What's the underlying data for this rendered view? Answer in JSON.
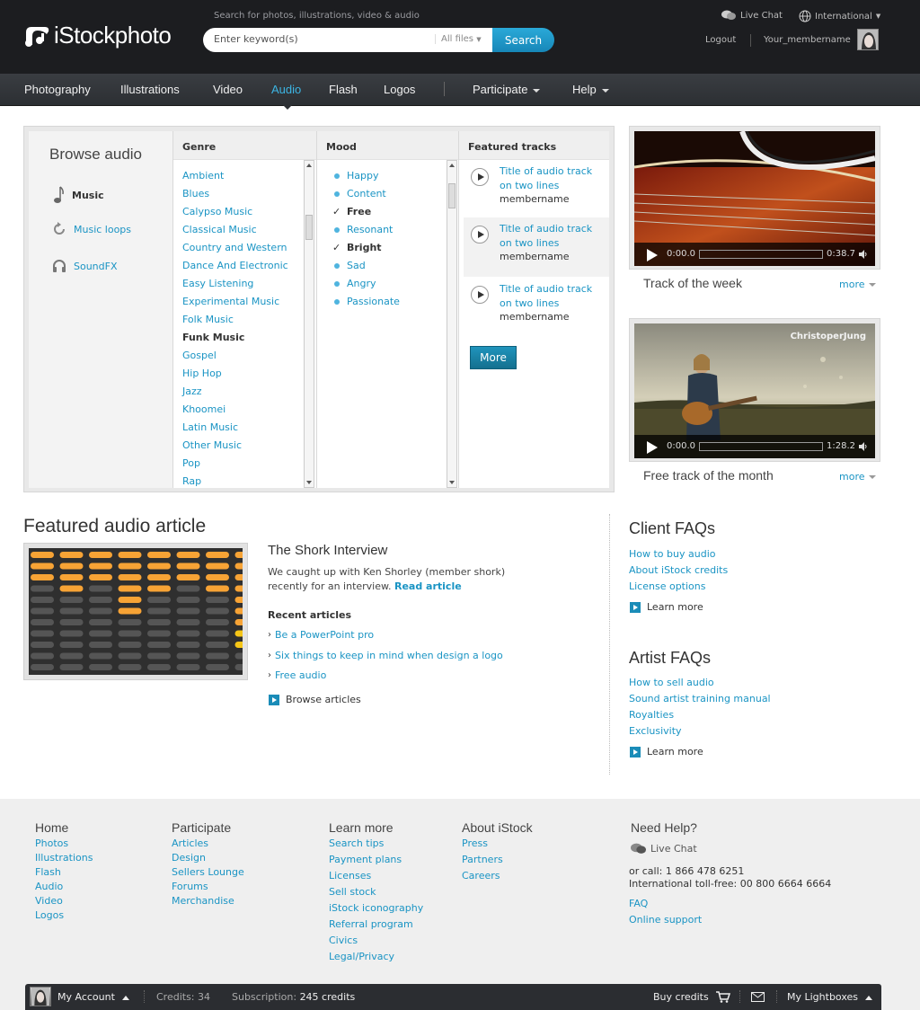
{
  "header": {
    "logo_text": "iStockphoto",
    "search_hint": "Search for photos, illustrations, video & audio",
    "search_placeholder": "Enter keyword(s)",
    "files_filter": "All files",
    "search_button": "Search",
    "live_chat": "Live Chat",
    "international": "International",
    "logout": "Logout",
    "member": "Your_membername"
  },
  "nav": {
    "items": [
      "Photography",
      "Illustrations",
      "Video",
      "Audio",
      "Flash",
      "Logos"
    ],
    "active": "Audio",
    "participate": "Participate",
    "help": "Help"
  },
  "browse": {
    "title": "Browse audio",
    "types": [
      "Music",
      "Music loops",
      "SoundFX"
    ],
    "active_type": "Music",
    "genre_header": "Genre",
    "mood_header": "Mood",
    "featured_header": "Featured tracks",
    "genres": [
      "Ambient",
      "Blues",
      "Calypso Music",
      "Classical Music",
      "Country and Western",
      "Dance And Electronic",
      "Easy Listening",
      "Experimental Music",
      "Folk Music",
      "Funk Music",
      "Gospel",
      "Hip Hop",
      "Jazz",
      "Khoomei",
      "Latin Music",
      "Other Music",
      "Pop",
      "Rap"
    ],
    "selected_genre": "Funk Music",
    "moods": [
      "Happy",
      "Content",
      "Free",
      "Resonant",
      "Bright",
      "Sad",
      "Angry",
      "Passionate"
    ],
    "checked_moods": [
      "Free",
      "Bright"
    ],
    "tracks": [
      {
        "title": "Title of audio track on two lines",
        "member": "membername"
      },
      {
        "title": "Title of audio track on two lines",
        "member": "membername"
      },
      {
        "title": "Title of audio track on two lines",
        "member": "membername"
      }
    ],
    "more_button": "More"
  },
  "videos": [
    {
      "current": "0:00.0",
      "duration": "0:38.7",
      "caption": "Track of the week",
      "more": "more"
    },
    {
      "current": "0:00.0",
      "duration": "1:28.2",
      "caption": "Free track of the month",
      "more": "more",
      "watermark": "ChristoperJung"
    }
  ],
  "article": {
    "section_title": "Featured audio article",
    "headline": "The Shork Interview",
    "desc": "We caught up with Ken Shorley (member shork) recently for an interview.",
    "read_link": "Read article",
    "recent_title": "Recent articles",
    "recent": [
      "Be a PowerPoint pro",
      "Six things to keep in mind when design a logo",
      "Free audio"
    ],
    "browse_link": "Browse articles"
  },
  "faqs": {
    "client_title": "Client FAQs",
    "client_links": [
      "How to buy audio",
      "About iStock credits",
      "License options"
    ],
    "artist_title": "Artist FAQs",
    "artist_links": [
      "How to sell audio",
      "Sound artist training manual",
      "Royalties",
      "Exclusivity"
    ],
    "learn_more": "Learn more"
  },
  "footer": {
    "home": {
      "title": "Home",
      "links": [
        "Photos",
        "Illustrations",
        "Flash",
        "Audio",
        "Video",
        "Logos"
      ]
    },
    "participate": {
      "title": "Participate",
      "links": [
        "Articles",
        "Design",
        "Sellers Lounge",
        "Forums",
        "Merchandise"
      ]
    },
    "learn": {
      "title": "Learn more",
      "links": [
        "Search tips",
        "Payment plans",
        "Licenses",
        "Sell stock",
        "iStock iconography",
        "Referral program",
        "Civics",
        "Legal/Privacy"
      ]
    },
    "about": {
      "title": "About iStock",
      "links": [
        "Press",
        "Partners",
        "Careers"
      ]
    },
    "help": {
      "title": "Need Help?",
      "live_chat": "Live Chat",
      "call": "or call: 1 866 478 6251",
      "intl": "International toll-free: 00 800 6664 6664",
      "links": [
        "FAQ",
        "Online support"
      ]
    }
  },
  "bottombar": {
    "account": "My Account",
    "credits_label": "Credits:",
    "credits_value": "34",
    "subscription_label": "Subscription:",
    "subscription_value": "245 credits",
    "buy_credits": "Buy credits",
    "lightboxes": "My Lightboxes"
  },
  "colors": {
    "accent": "#1a94c4",
    "nav_active": "#3cb5e3",
    "header_bg": "#1c1d20"
  }
}
